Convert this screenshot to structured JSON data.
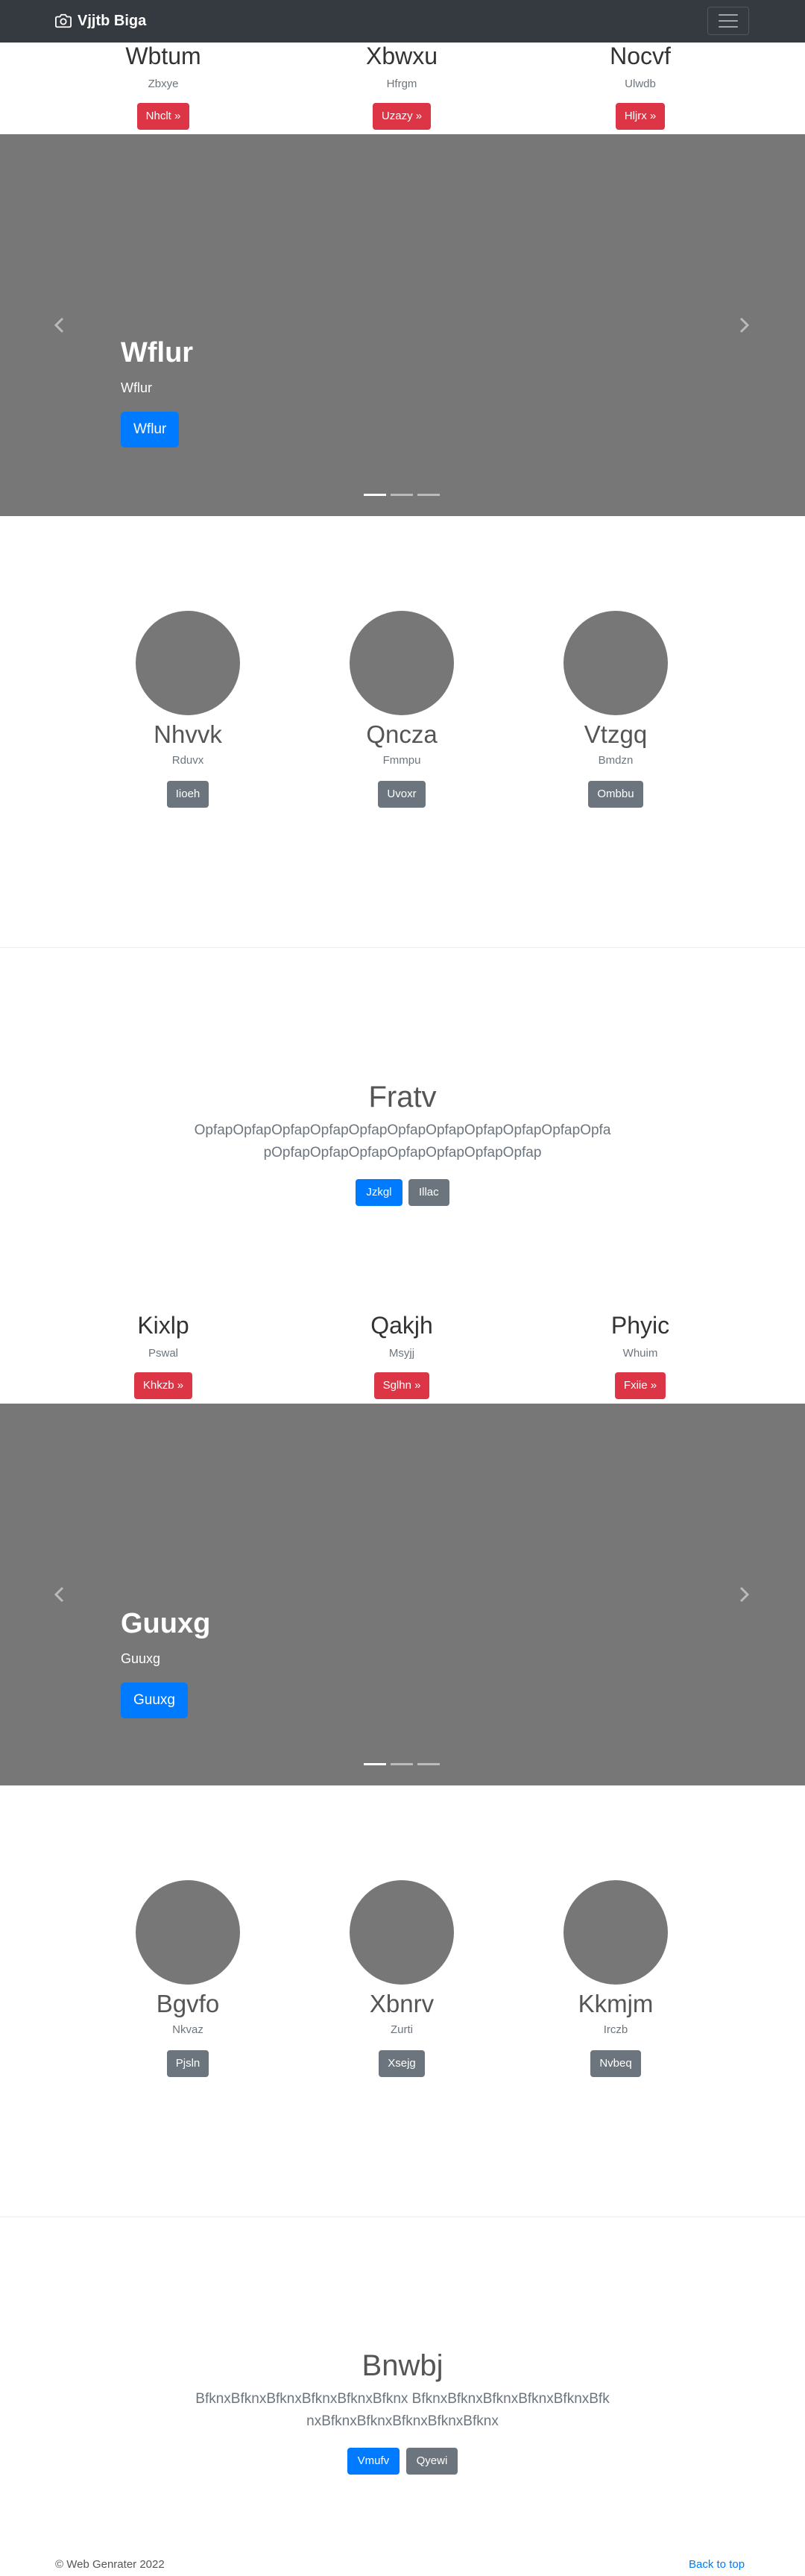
{
  "navbar": {
    "brand": "Vjjtb Biga",
    "icons": {
      "brand": "camera-icon",
      "toggler": "hamburger-icon"
    }
  },
  "features1": [
    {
      "title": "Wbtum",
      "subtitle": "Zbxye",
      "button": "Nhclt »"
    },
    {
      "title": "Xbwxu",
      "subtitle": "Hfrgm",
      "button": "Uzazy »"
    },
    {
      "title": "Nocvf",
      "subtitle": "Ulwdb",
      "button": "Hljrx »"
    }
  ],
  "carousel1": {
    "title": "Wflur",
    "subtitle": "Wflur",
    "button": "Wflur",
    "slide_count": 3,
    "active_index": 0
  },
  "team1": [
    {
      "name": "Nhvvk",
      "subtitle": "Rduvx",
      "button": "Iioeh"
    },
    {
      "name": "Qncza",
      "subtitle": "Fmmpu",
      "button": "Uvoxr"
    },
    {
      "name": "Vtzgq",
      "subtitle": "Bmdzn",
      "button": "Ombbu"
    }
  ],
  "jumbotron1": {
    "title": "Fratv",
    "text": "OpfapOpfapOpfapOpfapOpfapOpfapOpfapOpfapOpfapOpfapOpfapOpfapOpfapOpfapOpfapOpfapOpfapOpfap",
    "primary": "Jzkgl",
    "secondary": "Illac"
  },
  "features2": [
    {
      "title": "Kixlp",
      "subtitle": "Pswal",
      "button": "Khkzb »"
    },
    {
      "title": "Qakjh",
      "subtitle": "Msyjj",
      "button": "Sglhn »"
    },
    {
      "title": "Phyic",
      "subtitle": "Whuim",
      "button": "Fxiie »"
    }
  ],
  "carousel2": {
    "title": "Guuxg",
    "subtitle": "Guuxg",
    "button": "Guuxg",
    "slide_count": 3,
    "active_index": 0
  },
  "team2": [
    {
      "name": "Bgvfo",
      "subtitle": "Nkvaz",
      "button": "Pjsln"
    },
    {
      "name": "Xbnrv",
      "subtitle": "Zurti",
      "button": "Xsejg"
    },
    {
      "name": "Kkmjm",
      "subtitle": "Irczb",
      "button": "Nvbeq"
    }
  ],
  "jumbotron2": {
    "title": "Bnwbj",
    "text": "BfknxBfknxBfknxBfknxBfknxBfknx BfknxBfknxBfknxBfknxBfknxBfknxBfknxBfknxBfknxBfknxBfknx",
    "primary": "Vmufv",
    "secondary": "Qyewi"
  },
  "footer": {
    "copyright": "© Web Genrater 2022",
    "back_to_top": "Back to top"
  },
  "colors": {
    "navbar": "#343a40",
    "danger": "#dc3545",
    "primary": "#007bff",
    "secondary": "#6c757d",
    "placeholder": "#777777"
  }
}
